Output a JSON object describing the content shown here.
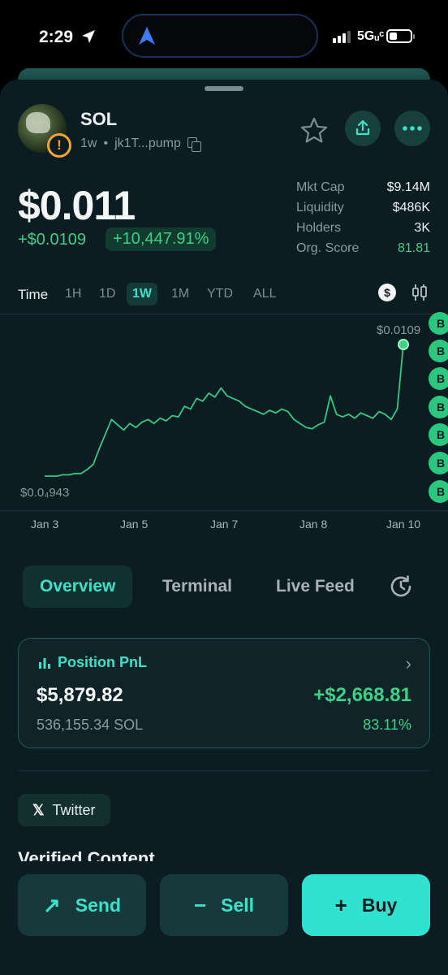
{
  "status_bar": {
    "time": "2:29",
    "network": "5Gᵤᶜ",
    "signal_bars": 3,
    "battery_level": 0.25
  },
  "token": {
    "name": "SOL",
    "age": "1w",
    "separator": "•",
    "address": "jk1T...pump",
    "warning_glyph": "!",
    "avatar_icon": "token-avatar"
  },
  "price": {
    "value": "$0.011",
    "change_usd": "+$0.0109",
    "change_pct": "+10,447.91%"
  },
  "stats": [
    {
      "label": "Mkt Cap",
      "value": "$9.14M"
    },
    {
      "label": "Liquidity",
      "value": "$486K"
    },
    {
      "label": "Holders",
      "value": "3K"
    },
    {
      "label": "Org. Score",
      "value": "81.81"
    }
  ],
  "range": {
    "label": "Time",
    "options": [
      "1H",
      "1D",
      "1W",
      "1M",
      "YTD",
      "ALL"
    ],
    "selected": "1W",
    "currency_glyph": "$"
  },
  "chart_data": {
    "type": "line",
    "x_ticks": [
      "Jan 3",
      "Jan 5",
      "Jan 7",
      "Jan 8",
      "Jan 10"
    ],
    "high_label": "$0.0109",
    "low_label": "$0.0₄943",
    "series": [
      {
        "values": [
          0.0009,
          0.0009,
          0.0009,
          0.001,
          0.001,
          0.0011,
          0.0011,
          0.0014,
          0.0018,
          0.003,
          0.0041,
          0.0052,
          0.0048,
          0.0044,
          0.0049,
          0.0046,
          0.005,
          0.0052,
          0.0049,
          0.0053,
          0.0051,
          0.0055,
          0.0054,
          0.0062,
          0.006,
          0.0068,
          0.0066,
          0.0072,
          0.0069,
          0.0076,
          0.007,
          0.0068,
          0.0066,
          0.0062,
          0.006,
          0.0058,
          0.0056,
          0.0059,
          0.0057,
          0.006,
          0.0058,
          0.0052,
          0.0049,
          0.0046,
          0.0045,
          0.0048,
          0.005,
          0.007,
          0.0056,
          0.0054,
          0.0056,
          0.0053,
          0.0057,
          0.0055,
          0.0053,
          0.0058,
          0.0056,
          0.0052,
          0.006,
          0.0109
        ]
      }
    ],
    "markers": [
      "B",
      "B",
      "B",
      "B",
      "B",
      "B",
      "B"
    ]
  },
  "tabs": [
    {
      "label": "Overview",
      "active": true
    },
    {
      "label": "Terminal",
      "active": false
    },
    {
      "label": "Live Feed",
      "active": false
    }
  ],
  "pnl": {
    "title": "Position PnL",
    "value_usd": "$5,879.82",
    "gain_usd": "+$2,668.81",
    "amount": "536,155.34 SOL",
    "gain_pct": "83.11%",
    "chevron": "›"
  },
  "socials": {
    "twitter_glyph": "𝕏",
    "twitter_label": "Twitter"
  },
  "partial_heading": "Verified Content",
  "actions": {
    "send": {
      "label": "Send",
      "glyph": "↗"
    },
    "sell": {
      "label": "Sell",
      "glyph": "−"
    },
    "buy": {
      "label": "Buy",
      "glyph": "+"
    }
  },
  "colors": {
    "accent": "#3fe0c8",
    "positive": "#3ed086",
    "sheet_bg": "#0b1c22",
    "warning": "#f2a33a"
  }
}
